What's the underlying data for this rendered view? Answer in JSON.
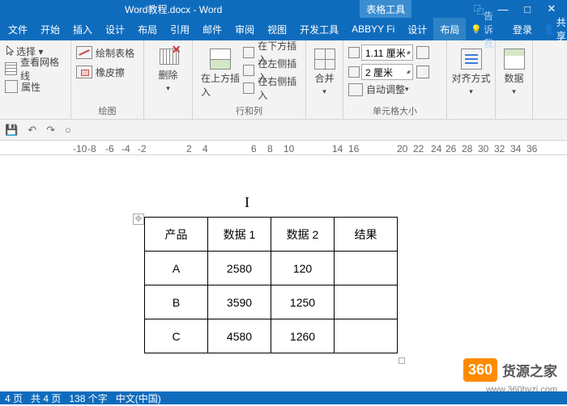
{
  "title": {
    "doc": "Word教程.docx - Word",
    "context_tab": "表格工具"
  },
  "window_buttons": {
    "restore": "⿻",
    "min": "—",
    "max": "□",
    "close": "✕"
  },
  "tabs": {
    "file": "文件",
    "home": "开始",
    "insert": "插入",
    "design": "设计",
    "layout": "布局",
    "references": "引用",
    "mailings": "邮件",
    "review": "审阅",
    "view": "视图",
    "developer": "开发工具",
    "abbyy": "ABBYY Fi",
    "tbl_design": "设计",
    "tbl_layout": "布局",
    "tell": "告诉我...",
    "login": "登录",
    "share": "共享"
  },
  "ribbon": {
    "g1": {
      "select": "选择 ▾",
      "gridlines": "查看网格线",
      "properties": "属性",
      "label": ""
    },
    "g2": {
      "draw": "绘制表格",
      "eraser": "橡皮擦",
      "label": "绘图"
    },
    "g3": {
      "delete": "删除",
      "label": ""
    },
    "g4": {
      "insert_above": "在上方插入",
      "insert_below": "在下方插入",
      "insert_left": "在左侧插入",
      "insert_right": "在右侧插入",
      "label": "行和列"
    },
    "g5": {
      "merge": "合并",
      "label": ""
    },
    "g6": {
      "height": "1.11 厘米",
      "width": "2 厘米",
      "autofit": "自动调整",
      "label": "单元格大小"
    },
    "g7": {
      "align": "对齐方式",
      "label": ""
    },
    "g8": {
      "data": "数据",
      "label": ""
    }
  },
  "ruler_marks": [
    "-10",
    "-8",
    "-6",
    "-4",
    "-2",
    "2",
    "4",
    "6",
    "8",
    "10",
    "14",
    "16",
    "20",
    "22",
    "24",
    "26",
    "28",
    "30",
    "32",
    "34",
    "36"
  ],
  "ruler_positions": [
    -10,
    8,
    30,
    50,
    70,
    130,
    150,
    210,
    230,
    250,
    310,
    330,
    390,
    410,
    432,
    450,
    470,
    490,
    510,
    530,
    550
  ],
  "table": {
    "headers": [
      "产品",
      "数据 1",
      "数据 2",
      "结果"
    ],
    "rows": [
      [
        "A",
        "2580",
        "120",
        ""
      ],
      [
        "B",
        "3590",
        "1250",
        ""
      ],
      [
        "C",
        "4580",
        "1260",
        ""
      ]
    ]
  },
  "anchor_glyph": "✥",
  "watermark": {
    "badge": "360",
    "text": "货源之家",
    "url": "www.360hyzj.com"
  },
  "status": {
    "page": "4 页",
    "total": "共 4 页",
    "words": "138 个字",
    "lang": "中文(中国)"
  }
}
